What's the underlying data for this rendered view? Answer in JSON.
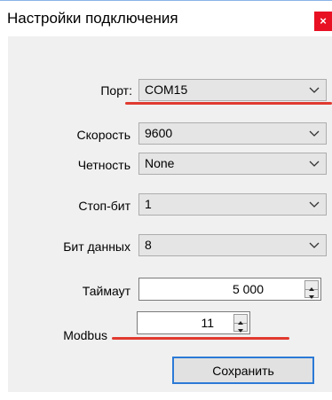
{
  "window": {
    "title": "Настройки подключения",
    "close_glyph": "×"
  },
  "form": {
    "port": {
      "label": "Порт:",
      "value": "COM15"
    },
    "speed": {
      "label": "Скорость",
      "value": "9600"
    },
    "parity": {
      "label": "Четность",
      "value": "None"
    },
    "stop_bits": {
      "label": "Стоп-бит",
      "value": "1"
    },
    "data_bits": {
      "label": "Бит данных",
      "value": "8"
    },
    "timeout": {
      "label": "Таймаут",
      "value": "5 000"
    },
    "modbus": {
      "label": "Modbus",
      "value": "11"
    }
  },
  "buttons": {
    "save_label": "Сохранить"
  },
  "colors": {
    "accent": "#2b7ad6",
    "annotation": "#e03a30",
    "close": "#e81123"
  },
  "icons": [
    "chevron-down-icon",
    "spin-up-icon",
    "spin-down-icon",
    "close-icon"
  ]
}
